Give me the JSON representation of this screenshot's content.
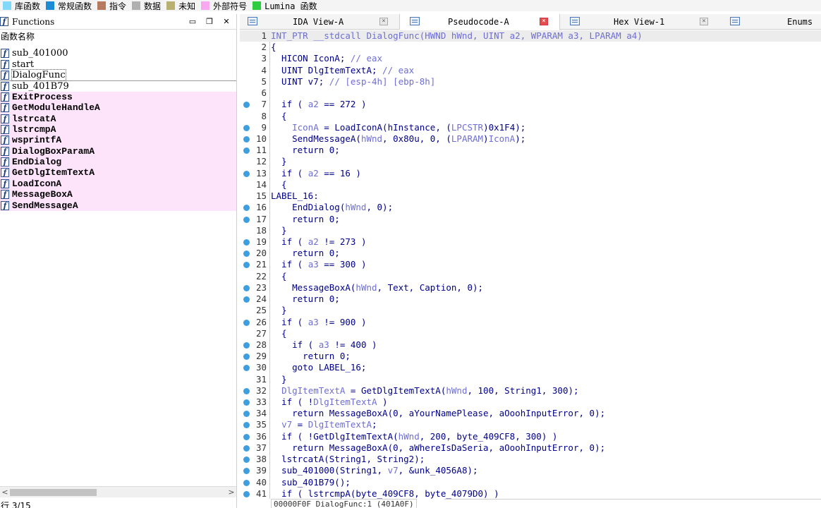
{
  "legend": [
    {
      "label": "库函数",
      "color": "#7fd9f7"
    },
    {
      "label": "常规函数",
      "color": "#1e8bd6"
    },
    {
      "label": "指令",
      "color": "#b87a5c"
    },
    {
      "label": "数据",
      "color": "#b0b0b0"
    },
    {
      "label": "未知",
      "color": "#b8b070"
    },
    {
      "label": "外部符号",
      "color": "#f7a8f0"
    },
    {
      "label": "Lumina 函数",
      "color": "#2ecc40"
    }
  ],
  "functions_panel": {
    "title": "Functions",
    "header": "函数名称",
    "items": [
      {
        "name": "sub_401000",
        "type": "regular"
      },
      {
        "name": "start",
        "type": "regular"
      },
      {
        "name": "DialogFunc",
        "type": "regular"
      },
      {
        "name": "sub_401B79",
        "type": "regular"
      },
      {
        "name": "ExitProcess",
        "type": "import"
      },
      {
        "name": "GetModuleHandleA",
        "type": "import"
      },
      {
        "name": "lstrcatA",
        "type": "import"
      },
      {
        "name": "lstrcmpA",
        "type": "import"
      },
      {
        "name": "wsprintfA",
        "type": "import"
      },
      {
        "name": "DialogBoxParamA",
        "type": "import"
      },
      {
        "name": "EndDialog",
        "type": "import"
      },
      {
        "name": "GetDlgItemTextA",
        "type": "import"
      },
      {
        "name": "LoadIconA",
        "type": "import"
      },
      {
        "name": "MessageBoxA",
        "type": "import"
      },
      {
        "name": "SendMessageA",
        "type": "import"
      }
    ],
    "status": "行 3/15"
  },
  "tabs": [
    {
      "label": "IDA View-A",
      "active": false
    },
    {
      "label": "Pseudocode-A",
      "active": true
    },
    {
      "label": "Hex View-1",
      "active": false
    },
    {
      "label": "Enums",
      "active": false
    }
  ],
  "code_lines": [
    {
      "n": "1",
      "bp": false,
      "t": "INT_PTR __stdcall DialogFunc(HWND hWnd, UINT a2, WPARAM a3, LPARAM a4)"
    },
    {
      "n": "2",
      "bp": false,
      "t": "{"
    },
    {
      "n": "3",
      "bp": false,
      "t": "  HICON IconA; // eax"
    },
    {
      "n": "4",
      "bp": false,
      "t": "  UINT DlgItemTextA; // eax"
    },
    {
      "n": "5",
      "bp": false,
      "t": "  UINT v7; // [esp-4h] [ebp-8h]"
    },
    {
      "n": "6",
      "bp": false,
      "t": ""
    },
    {
      "n": "7",
      "bp": true,
      "t": "  if ( a2 == 272 )"
    },
    {
      "n": "8",
      "bp": false,
      "t": "  {"
    },
    {
      "n": "9",
      "bp": true,
      "t": "    IconA = LoadIconA(hInstance, (LPCSTR)0x1F4);"
    },
    {
      "n": "10",
      "bp": true,
      "t": "    SendMessageA(hWnd, 0x80u, 0, (LPARAM)IconA);"
    },
    {
      "n": "11",
      "bp": true,
      "t": "    return 0;"
    },
    {
      "n": "12",
      "bp": false,
      "t": "  }"
    },
    {
      "n": "13",
      "bp": true,
      "t": "  if ( a2 == 16 )"
    },
    {
      "n": "14",
      "bp": false,
      "t": "  {"
    },
    {
      "n": "15",
      "bp": false,
      "t": "LABEL_16:"
    },
    {
      "n": "16",
      "bp": true,
      "t": "    EndDialog(hWnd, 0);"
    },
    {
      "n": "17",
      "bp": true,
      "t": "    return 0;"
    },
    {
      "n": "18",
      "bp": false,
      "t": "  }"
    },
    {
      "n": "19",
      "bp": true,
      "t": "  if ( a2 != 273 )"
    },
    {
      "n": "20",
      "bp": true,
      "t": "    return 0;"
    },
    {
      "n": "21",
      "bp": true,
      "t": "  if ( a3 == 300 )"
    },
    {
      "n": "22",
      "bp": false,
      "t": "  {"
    },
    {
      "n": "23",
      "bp": true,
      "t": "    MessageBoxA(hWnd, Text, Caption, 0);"
    },
    {
      "n": "24",
      "bp": true,
      "t": "    return 0;"
    },
    {
      "n": "25",
      "bp": false,
      "t": "  }"
    },
    {
      "n": "26",
      "bp": true,
      "t": "  if ( a3 != 900 )"
    },
    {
      "n": "27",
      "bp": false,
      "t": "  {"
    },
    {
      "n": "28",
      "bp": true,
      "t": "    if ( a3 != 400 )"
    },
    {
      "n": "29",
      "bp": true,
      "t": "      return 0;"
    },
    {
      "n": "30",
      "bp": true,
      "t": "    goto LABEL_16;"
    },
    {
      "n": "31",
      "bp": false,
      "t": "  }"
    },
    {
      "n": "32",
      "bp": true,
      "t": "  DlgItemTextA = GetDlgItemTextA(hWnd, 100, String1, 300);"
    },
    {
      "n": "33",
      "bp": true,
      "t": "  if ( !DlgItemTextA )"
    },
    {
      "n": "34",
      "bp": true,
      "t": "    return MessageBoxA(0, aYourNamePlease, aOoohInputError, 0);"
    },
    {
      "n": "35",
      "bp": true,
      "t": "  v7 = DlgItemTextA;"
    },
    {
      "n": "36",
      "bp": true,
      "t": "  if ( !GetDlgItemTextA(hWnd, 200, byte_409CF8, 300) )"
    },
    {
      "n": "37",
      "bp": true,
      "t": "    return MessageBoxA(0, aWhereIsDaSeria, aOoohInputError, 0);"
    },
    {
      "n": "38",
      "bp": true,
      "t": "  lstrcatA(String1, String2);"
    },
    {
      "n": "39",
      "bp": true,
      "t": "  sub_401000(String1, v7, &unk_4056A8);"
    },
    {
      "n": "40",
      "bp": true,
      "t": "  sub_401B79();"
    },
    {
      "n": "41",
      "bp": true,
      "t": "  if ( lstrcmpA(byte_409CF8, byte_4079D0) )"
    }
  ],
  "status_bar": "00000F0F DialogFunc:1 (401A0F)"
}
